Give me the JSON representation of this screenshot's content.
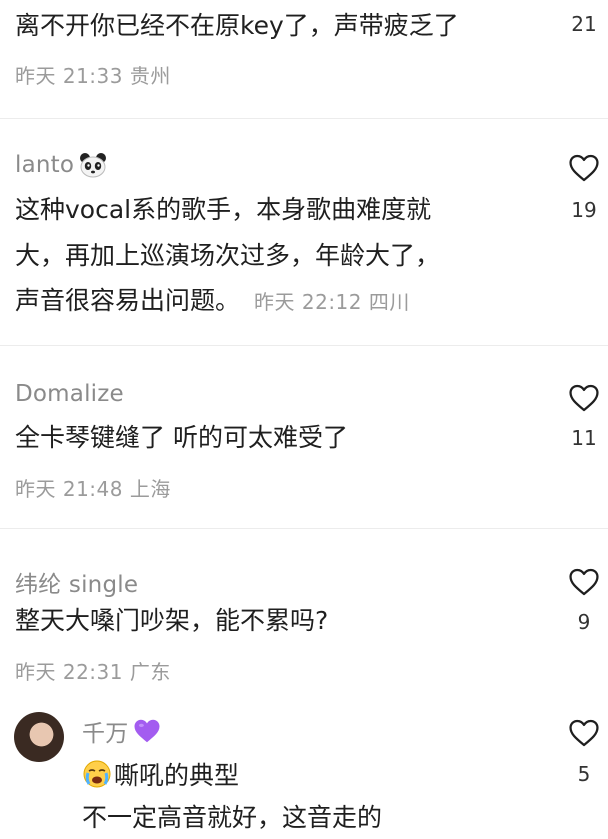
{
  "comments": [
    {
      "username": "",
      "lines": [
        "离不开你已经不在原key了，声带疲乏了"
      ],
      "meta": "昨天 21:33 贵州",
      "likes": "21"
    },
    {
      "username": "lanto",
      "username_icon": "panda-icon",
      "lines": [
        "这种vocal系的歌手，本身歌曲难度就",
        "大，再加上巡演场次过多，年龄大了，",
        "声音很容易出问题。"
      ],
      "meta": "昨天 22:12 四川",
      "likes": "19"
    },
    {
      "username": "Domalize",
      "lines": [
        "全卡琴键缝了 听的可太难受了"
      ],
      "meta": "昨天 21:48 上海",
      "likes": "11"
    },
    {
      "username": "纬纶 single",
      "lines": [
        "整天大嗓门吵架，能不累吗?"
      ],
      "meta": "昨天 22:31 广东",
      "likes": "9"
    },
    {
      "username": "千万",
      "username_icon": "purple-heart-icon",
      "lead_icon": "crying-face-icon",
      "lines": [
        "嘶吼的典型",
        "不一定高音就好，这音走的"
      ],
      "likes": "5"
    }
  ],
  "colors": {
    "username": "#8a8a8a",
    "meta": "#9b9b9b",
    "divider": "#ececec",
    "heart_outline": "#1f1f1f",
    "purple_heart": "#a35cf0"
  }
}
